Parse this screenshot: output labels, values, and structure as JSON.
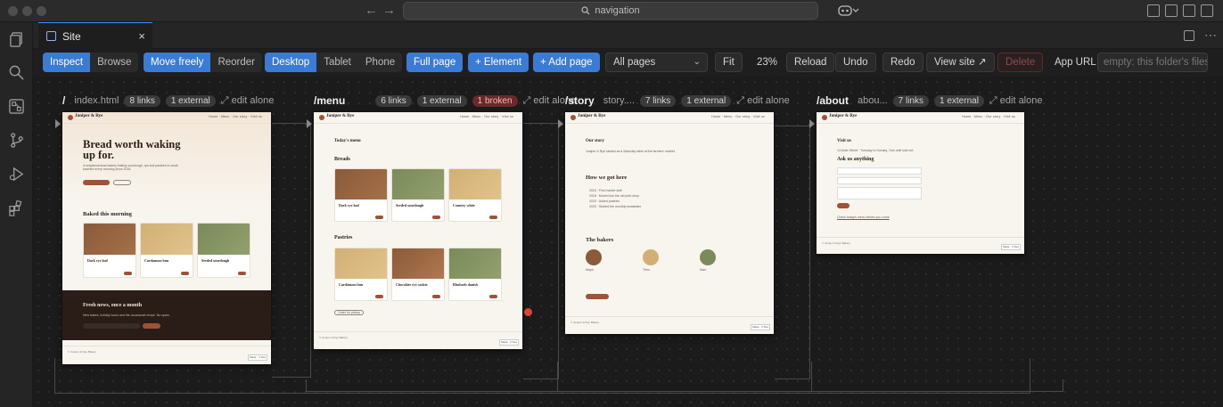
{
  "titlebar": {
    "search_text": "navigation",
    "search_icon": "magnifier-icon",
    "back_icon": "arrow-left-icon",
    "forward_icon": "arrow-right-icon"
  },
  "tab": {
    "label": "Site",
    "close": "×"
  },
  "toolbar": {
    "inspect": "Inspect",
    "browse": "Browse",
    "move_freely": "Move freely",
    "reorder": "Reorder",
    "desktop": "Desktop",
    "tablet": "Tablet",
    "phone": "Phone",
    "full_page": "Full page",
    "element": "+ Element",
    "add_page": "+ Add page",
    "pages_select": "All pages",
    "fit": "Fit",
    "zoom": "23%",
    "reload": "Reload",
    "undo": "Undo",
    "redo": "Redo",
    "view_site": "View site ↗",
    "delete": "Delete",
    "app_url_label": "App URL",
    "app_url_placeholder": "empty: this folder's files"
  },
  "pages": [
    {
      "route": "/",
      "file": "index.html",
      "links": "8 links",
      "external": "1 external",
      "broken": "",
      "edit": "⤢ edit alone"
    },
    {
      "route": "/menu",
      "file": "",
      "links": "6 links",
      "external": "1 external",
      "broken": "1 broken",
      "edit": "⤢ edit alone"
    },
    {
      "route": "/story",
      "file": "story....",
      "links": "7 links",
      "external": "1 external",
      "broken": "",
      "edit": "⤢ edit alone"
    },
    {
      "route": "/about",
      "file": "abou...",
      "links": "7 links",
      "external": "1 external",
      "broken": "",
      "edit": "⤢ edit alone"
    }
  ],
  "thumbs": {
    "brand": "Juniper & Rye",
    "home": {
      "hero": "Bread worth waking up for.",
      "hero_sub": "A neighbourhood bakery baking sourdough, rye and pastries in small batches every morning since 2016.",
      "section": "Baked this morning",
      "cards": [
        "Dark rye loaf",
        "Cardamom bun",
        "Seeded sourdough"
      ],
      "newsletter_title": "Fresh news, once a month",
      "newsletter_sub": "New bakes, holiday hours and the occasional recipe. No spam.",
      "subscribe": "Subscribe"
    },
    "menu": {
      "title": "Today's menu",
      "breads": "Breads",
      "bread_cards": [
        "Dark rye loaf",
        "Seeded sourdough",
        "Country white"
      ],
      "pastries": "Pastries",
      "pastry_cards": [
        "Cardamom bun",
        "Chocolate rye cookie",
        "Rhubarb danish"
      ],
      "order": "Order for pickup"
    },
    "story": {
      "title": "Our story",
      "how": "How we got here",
      "bakers": "The bakers",
      "names": [
        "Maya",
        "Theo",
        "Sam"
      ],
      "cta": "Come and visit"
    },
    "about": {
      "title": "Visit us",
      "ask": "Ask us anything",
      "send": "Send"
    }
  },
  "colors": {
    "accent": "#3a7bd5",
    "brand": "#a05236",
    "dark_band": "#2a1d17",
    "broken": "#6a2a2a"
  }
}
